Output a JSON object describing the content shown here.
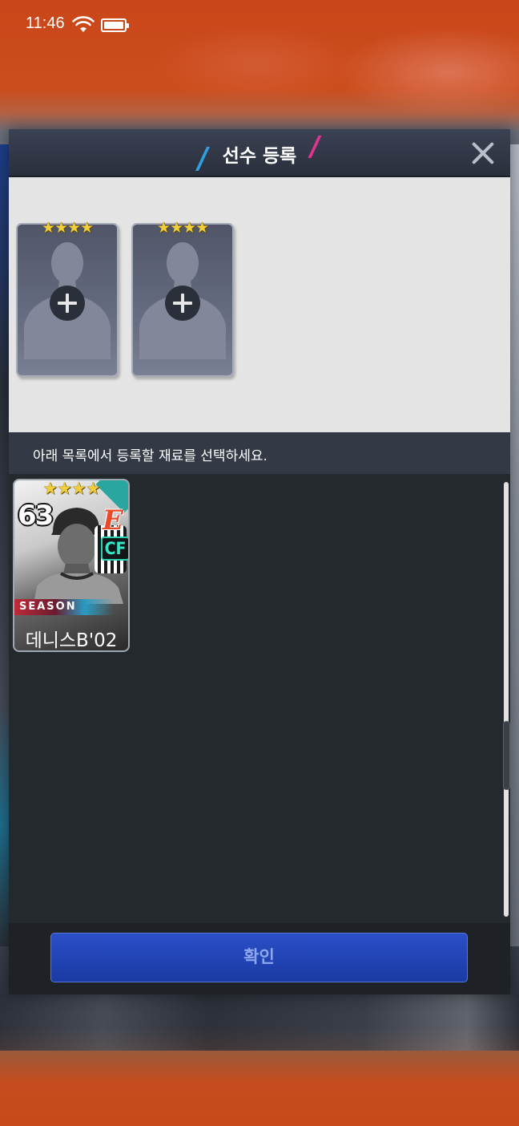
{
  "status_bar": {
    "time": "11:46"
  },
  "dialog": {
    "title": "선수 등록",
    "slots": [
      {
        "stars": "★★★★"
      },
      {
        "stars": "★★★★"
      }
    ],
    "instruction": "아래 목록에서 등록할 재료를 선택하세요.",
    "player_cards": [
      {
        "stars": "★★★★",
        "overall": "63",
        "position": "CF",
        "team_logo": "E",
        "season": "SEASON",
        "name": "데니스B'02"
      }
    ],
    "confirm_label": "확인"
  },
  "colors": {
    "accent_blue": "#2a4fc7",
    "title_slash_blue": "#2f9fe0",
    "title_slash_pink": "#e0348e",
    "star_gold": "#f2cf3a",
    "position_teal": "#35e6c6"
  }
}
